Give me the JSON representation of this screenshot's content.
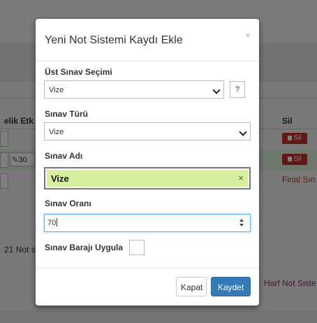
{
  "background": {
    "col_partial_label": "elik Etk",
    "col_delete_label": "Sil",
    "delete_label": "Sil",
    "cell_value": "30",
    "final_text": "Final Sın",
    "count_text": "21 Not s",
    "harf_link": "Harf Not Siste"
  },
  "modal": {
    "title": "Yeni Not Sistemi Kaydı Ekle",
    "close_symbol": "×",
    "ust_sinav": {
      "label": "Üst Sınav Seçimi",
      "value": "Vize",
      "help": "?"
    },
    "sinav_turu": {
      "label": "Sınav Türü",
      "value": "Vize"
    },
    "sinav_adi": {
      "label": "Sınav Adı",
      "value": "Vize",
      "clear": "×"
    },
    "sinav_orani": {
      "label": "Sınav Oranı",
      "value": "70"
    },
    "baraj": {
      "label": "Sınav Barajı Uygula"
    },
    "buttons": {
      "close": "Kapat",
      "save": "Kaydet"
    }
  },
  "colors": {
    "primary": "#337ab7",
    "danger": "#c9302c",
    "name_highlight": "#d5ef9e",
    "focus_border": "#66afe9"
  }
}
